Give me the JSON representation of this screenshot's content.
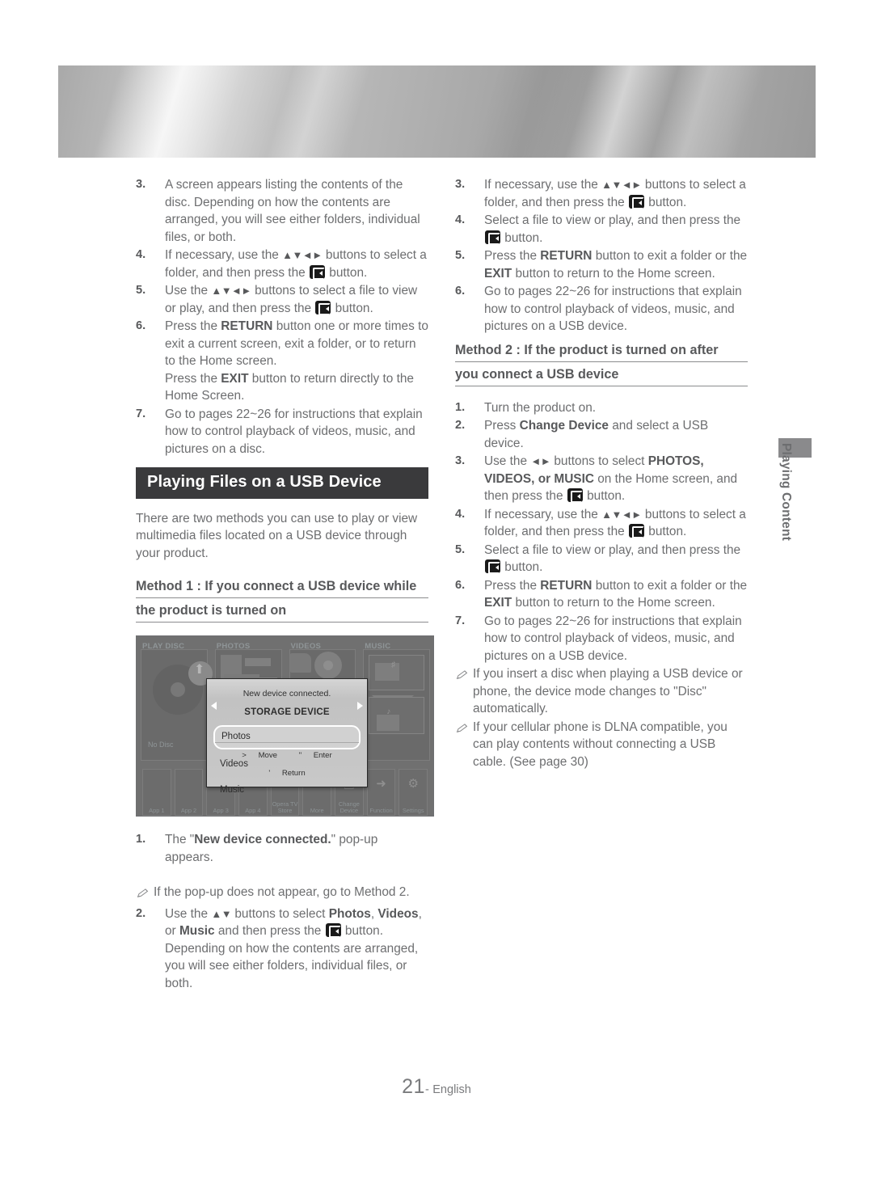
{
  "header": {
    "banner_alt": "metallic gradient banner"
  },
  "side_tab": {
    "label": "Playing Content"
  },
  "footer": {
    "page_number": "21",
    "separator": "-",
    "language": "English"
  },
  "left_column": {
    "steps_disc": [
      {
        "num": "3.",
        "text": "A screen appears listing the contents of the disc. Depending on how the contents are arranged, you will see either folders, individual files, or both."
      },
      {
        "num": "4.",
        "text_a": "If necessary, use the ",
        "arrows": "▲▼◄►",
        "text_b": " buttons to select a folder, and then press the ",
        "text_c": " button."
      },
      {
        "num": "5.",
        "text_a": "Use the ",
        "arrows": "▲▼◄►",
        "text_b": " buttons to select a file to view or play, and then press the ",
        "text_c": " button."
      },
      {
        "num": "6.",
        "text_a": "Press the ",
        "bold_a": "RETURN",
        "text_b": " button one or more times to exit a current screen, exit a folder, or to return to the Home screen.",
        "text_c": "Press the ",
        "bold_b": "EXIT",
        "text_d": " button to return directly to the Home Screen."
      },
      {
        "num": "7.",
        "text": "Go to pages 22~26 for instructions that explain how to control playback of videos, music, and pictures on a disc."
      }
    ],
    "section_title": "Playing Files on a USB Device",
    "intro": "There are two methods you can use to play or view multimedia files located on a USB device through your product.",
    "method1": {
      "line1": "Method 1 : If you connect a USB device while",
      "line2": "the product is turned on"
    },
    "method1_steps": [
      {
        "num": "1.",
        "text_a": "The \"",
        "bold_a": "New device connected.",
        "text_b": "\" pop-up appears."
      }
    ],
    "method1_note": {
      "icon": "pencil-icon",
      "text": "If the pop-up does not appear, go to Method 2."
    },
    "method1_step2": {
      "num": "2.",
      "text_a": "Use the ",
      "arrows": "▲▼",
      "text_b": " buttons to select ",
      "bold_a": "Photos",
      "text_c": ", ",
      "bold_b": "Videos",
      "text_d": ", or ",
      "bold_c": "Music",
      "text_e": " and then press the ",
      "text_f": " button. Depending on how the contents are arranged, you will see either folders, individual files, or both."
    }
  },
  "right_column": {
    "steps_disc_cont": [
      {
        "num": "3.",
        "text_a": "If necessary, use the ",
        "arrows": "▲▼◄►",
        "text_b": " buttons to select a folder, and then press the ",
        "text_c": " button."
      },
      {
        "num": "4.",
        "text_a": "Select a file to view or play, and then press the ",
        "text_c": " button."
      },
      {
        "num": "5.",
        "text_a": "Press the ",
        "bold_a": "RETURN",
        "text_b": " button to exit a folder or the ",
        "bold_b": "EXIT",
        "text_c": " button to return to the Home screen."
      },
      {
        "num": "6.",
        "text": "Go to pages 22~26 for instructions that explain how to control playback of videos, music, and pictures on a USB device."
      }
    ],
    "method2": {
      "line1": "Method 2 : If the product is turned on after",
      "line2": "you connect a USB device"
    },
    "method2_steps": [
      {
        "num": "1.",
        "text": "Turn the product on."
      },
      {
        "num": "2.",
        "text_a": "Press ",
        "bold_a": "Change Device",
        "text_b": " and select a USB device."
      },
      {
        "num": "3.",
        "text_a": "Use the ",
        "arrows": "◄►",
        "text_b": " buttons to select ",
        "bold_a": "PHOTOS, VIDEOS, or MUSIC",
        "text_c": "  on the Home screen, and then press the ",
        "text_d": " button."
      },
      {
        "num": "4.",
        "text_a": "If necessary, use the ",
        "arrows": "▲▼◄►",
        "text_b": " buttons to select a folder, and then press the ",
        "text_c": " button."
      },
      {
        "num": "5.",
        "text_a": "Select a file to view or play, and then press the ",
        "text_c": " button."
      },
      {
        "num": "6.",
        "text_a": "Press the ",
        "bold_a": "RETURN",
        "text_b": " button to exit a folder or the ",
        "bold_b": "EXIT",
        "text_c": " button to return to the Home screen."
      },
      {
        "num": "7.",
        "text": "Go to pages 22~26 for instructions that explain how to control playback of videos, music, and pictures on a USB device."
      }
    ],
    "notes": [
      {
        "icon": "pencil-icon",
        "text": "If you insert a disc when playing a USB device or phone, the device mode changes to \"Disc\" automatically."
      },
      {
        "icon": "pencil-icon",
        "text": "If your cellular phone is DLNA compatible, you can play contents without connecting a USB cable. (See page 30)"
      }
    ]
  },
  "screenshot": {
    "tiles": [
      {
        "caption": "PLAY DISC",
        "status": "No Disc"
      },
      {
        "caption": "PHOTOS"
      },
      {
        "caption": "VIDEOS"
      },
      {
        "caption": "MUSIC"
      }
    ],
    "apps": [
      {
        "label": "App 1"
      },
      {
        "label": "App 2"
      },
      {
        "label": "App 3"
      },
      {
        "label": "App 4"
      },
      {
        "label": "Opera TV Store",
        "icon": "opera-icon"
      },
      {
        "label": "More",
        "icon": "plus-icon"
      },
      {
        "label": "Change Device",
        "icon": "device-icon"
      },
      {
        "label": "Function",
        "icon": "arrow-right-icon"
      },
      {
        "label": "Settings",
        "icon": "gear-icon"
      }
    ],
    "popup": {
      "title": "New device connected.",
      "device": "STORAGE DEVICE",
      "options": [
        "Photos",
        "Videos",
        "Music"
      ],
      "selected": "Photos",
      "hints": [
        "Move",
        "Enter",
        "Return"
      ],
      "hint_move_glyph": ">",
      "hint_enter_glyph": "\"",
      "hint_return_glyph": "'"
    }
  }
}
